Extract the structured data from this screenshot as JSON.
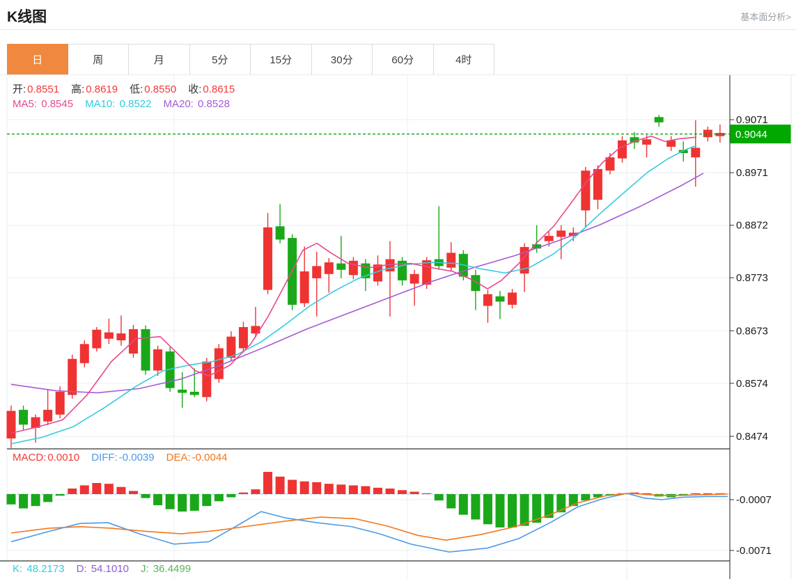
{
  "header": {
    "title": "K线图",
    "link": "基本面分析>"
  },
  "tabs": {
    "items": [
      {
        "label": "日",
        "selected": true
      },
      {
        "label": "周",
        "selected": false
      },
      {
        "label": "月",
        "selected": false
      },
      {
        "label": "5分",
        "selected": false
      },
      {
        "label": "15分",
        "selected": false
      },
      {
        "label": "30分",
        "selected": false
      },
      {
        "label": "60分",
        "selected": false
      },
      {
        "label": "4时",
        "selected": false
      }
    ]
  },
  "legend": {
    "ohlc": [
      {
        "label": "开:",
        "value": "0.8551"
      },
      {
        "label": "高:",
        "value": "0.8619"
      },
      {
        "label": "低:",
        "value": "0.8550"
      },
      {
        "label": "收:",
        "value": "0.8615"
      }
    ],
    "ma": [
      {
        "label": "MA5:",
        "value": "0.8545",
        "color": "#e8488f"
      },
      {
        "label": "MA10:",
        "value": "0.8522",
        "color": "#33ccdd"
      },
      {
        "label": "MA20:",
        "value": "0.8528",
        "color": "#a55bd6"
      }
    ]
  },
  "macd_legend": [
    {
      "label": "MACD:",
      "value": "0.0010",
      "color": "#f53838"
    },
    {
      "label": "DIFF:",
      "value": "-0.0039",
      "color": "#4d9ae8"
    },
    {
      "label": "DEA:",
      "value": "-0.0044",
      "color": "#f2771c"
    }
  ],
  "kdj_legend": [
    {
      "label": "K:",
      "value": "48.2173",
      "color": "#33ccdd"
    },
    {
      "label": "D:",
      "value": "54.1010",
      "color": "#8e5bd6"
    },
    {
      "label": "J:",
      "value": "36.4499",
      "color": "#58b258"
    }
  ],
  "colors": {
    "up_candle": "#ef3333",
    "down_candle": "#1aa81a",
    "current_price_tag": "#00a800",
    "selected_tab": "#f0883f",
    "grid": "#e9eff6",
    "axis": "#444444"
  },
  "chart_data": [
    {
      "type": "candlestick",
      "panel": "main",
      "title": "K线图 (daily)",
      "y_axis_ticks": [
        0.9071,
        0.8971,
        0.8872,
        0.8773,
        0.8673,
        0.8574,
        0.8474
      ],
      "current_price": 0.9044,
      "current_price_label": "0.9044",
      "grid_vertical_x": [
        250,
        585,
        900
      ],
      "up_color": "#ef3333",
      "down_color": "#1aa81a",
      "candles": [
        [
          0.847,
          0.8532,
          0.8452,
          0.8522
        ],
        [
          0.8524,
          0.8532,
          0.8486,
          0.8496
        ],
        [
          0.849,
          0.8515,
          0.8462,
          0.851
        ],
        [
          0.8502,
          0.8562,
          0.8495,
          0.8524
        ],
        [
          0.8515,
          0.8568,
          0.8508,
          0.8558
        ],
        [
          0.8552,
          0.8628,
          0.8545,
          0.862
        ],
        [
          0.8612,
          0.8655,
          0.8604,
          0.8648
        ],
        [
          0.864,
          0.868,
          0.8634,
          0.8675
        ],
        [
          0.8658,
          0.8696,
          0.8648,
          0.867
        ],
        [
          0.8655,
          0.8702,
          0.8645,
          0.8668
        ],
        [
          0.863,
          0.8684,
          0.8622,
          0.8676
        ],
        [
          0.8676,
          0.8683,
          0.859,
          0.8598
        ],
        [
          0.8598,
          0.8645,
          0.8588,
          0.8638
        ],
        [
          0.8634,
          0.8642,
          0.8558,
          0.8565
        ],
        [
          0.8562,
          0.8595,
          0.8528,
          0.8556
        ],
        [
          0.8558,
          0.8602,
          0.8548,
          0.8552
        ],
        [
          0.8548,
          0.8622,
          0.854,
          0.8615
        ],
        [
          0.8582,
          0.8648,
          0.8575,
          0.864
        ],
        [
          0.8622,
          0.8672,
          0.8615,
          0.8662
        ],
        [
          0.864,
          0.869,
          0.8632,
          0.868
        ],
        [
          0.8668,
          0.8718,
          0.866,
          0.8682
        ],
        [
          0.875,
          0.8895,
          0.8742,
          0.8868
        ],
        [
          0.887,
          0.8912,
          0.8838,
          0.8845
        ],
        [
          0.8848,
          0.8855,
          0.8712,
          0.8722
        ],
        [
          0.8725,
          0.8832,
          0.8718,
          0.8785
        ],
        [
          0.8772,
          0.8822,
          0.87,
          0.8795
        ],
        [
          0.878,
          0.881,
          0.8745,
          0.8802
        ],
        [
          0.88,
          0.8852,
          0.8772,
          0.8788
        ],
        [
          0.8778,
          0.8812,
          0.877,
          0.8805
        ],
        [
          0.88,
          0.8808,
          0.8748,
          0.8772
        ],
        [
          0.8766,
          0.8815,
          0.8758,
          0.8798
        ],
        [
          0.8785,
          0.8842,
          0.87,
          0.8808
        ],
        [
          0.8805,
          0.8812,
          0.8758,
          0.8768
        ],
        [
          0.8762,
          0.8788,
          0.872,
          0.878
        ],
        [
          0.876,
          0.8812,
          0.8752,
          0.8806
        ],
        [
          0.8808,
          0.8908,
          0.8788,
          0.8795
        ],
        [
          0.8792,
          0.884,
          0.8785,
          0.882
        ],
        [
          0.8818,
          0.8825,
          0.8768,
          0.8775
        ],
        [
          0.8778,
          0.8788,
          0.8712,
          0.8748
        ],
        [
          0.872,
          0.875,
          0.8688,
          0.8742
        ],
        [
          0.8738,
          0.8748,
          0.8695,
          0.8728
        ],
        [
          0.8722,
          0.8752,
          0.8715,
          0.8745
        ],
        [
          0.8781,
          0.8838,
          0.8746,
          0.8831
        ],
        [
          0.8836,
          0.8872,
          0.882,
          0.8828
        ],
        [
          0.8842,
          0.886,
          0.8832,
          0.8852
        ],
        [
          0.885,
          0.8872,
          0.8808,
          0.8862
        ],
        [
          0.8852,
          0.8868,
          0.8842,
          0.8858
        ],
        [
          0.89,
          0.8982,
          0.8868,
          0.8975
        ],
        [
          0.892,
          0.8985,
          0.8902,
          0.8978
        ],
        [
          0.8975,
          0.9008,
          0.8968,
          0.9
        ],
        [
          0.8998,
          0.904,
          0.899,
          0.9032
        ],
        [
          0.9038,
          0.9048,
          0.9016,
          0.9028
        ],
        [
          0.9024,
          0.9042,
          0.9,
          0.9034
        ],
        [
          0.9076,
          0.908,
          0.9058,
          0.9066
        ],
        [
          0.902,
          0.904,
          0.9012,
          0.9032
        ],
        [
          0.9014,
          0.903,
          0.8992,
          0.9008
        ],
        [
          0.9,
          0.907,
          0.8945,
          0.9018
        ],
        [
          0.9038,
          0.9058,
          0.903,
          0.9052
        ],
        [
          0.904,
          0.9062,
          0.9028,
          0.9046
        ]
      ],
      "ma5": [
        [
          16,
          0.848
        ],
        [
          55,
          0.8492
        ],
        [
          90,
          0.8505
        ],
        [
          125,
          0.8552
        ],
        [
          160,
          0.8615
        ],
        [
          195,
          0.8658
        ],
        [
          230,
          0.8662
        ],
        [
          255,
          0.863
        ],
        [
          280,
          0.8598
        ],
        [
          300,
          0.8588
        ],
        [
          330,
          0.8608
        ],
        [
          360,
          0.8648
        ],
        [
          385,
          0.87
        ],
        [
          410,
          0.8762
        ],
        [
          435,
          0.8825
        ],
        [
          455,
          0.8838
        ],
        [
          475,
          0.882
        ],
        [
          500,
          0.88
        ],
        [
          530,
          0.8792
        ],
        [
          560,
          0.8798
        ],
        [
          590,
          0.88
        ],
        [
          620,
          0.8792
        ],
        [
          650,
          0.8785
        ],
        [
          680,
          0.8768
        ],
        [
          700,
          0.8752
        ],
        [
          720,
          0.8768
        ],
        [
          745,
          0.88
        ],
        [
          770,
          0.8838
        ],
        [
          795,
          0.887
        ],
        [
          815,
          0.8905
        ],
        [
          840,
          0.895
        ],
        [
          865,
          0.899
        ],
        [
          890,
          0.9018
        ],
        [
          915,
          0.9032
        ],
        [
          935,
          0.904
        ],
        [
          955,
          0.903
        ],
        [
          975,
          0.9035
        ],
        [
          1000,
          0.9038
        ]
      ],
      "ma10": [
        [
          16,
          0.846
        ],
        [
          60,
          0.8472
        ],
        [
          105,
          0.8492
        ],
        [
          150,
          0.8528
        ],
        [
          195,
          0.8568
        ],
        [
          235,
          0.8598
        ],
        [
          270,
          0.8608
        ],
        [
          305,
          0.8615
        ],
        [
          340,
          0.8628
        ],
        [
          375,
          0.8652
        ],
        [
          410,
          0.8685
        ],
        [
          445,
          0.872
        ],
        [
          480,
          0.8748
        ],
        [
          515,
          0.8772
        ],
        [
          550,
          0.8788
        ],
        [
          585,
          0.8798
        ],
        [
          620,
          0.8802
        ],
        [
          655,
          0.88
        ],
        [
          690,
          0.879
        ],
        [
          725,
          0.8782
        ],
        [
          760,
          0.8792
        ],
        [
          795,
          0.8818
        ],
        [
          830,
          0.8855
        ],
        [
          865,
          0.8898
        ],
        [
          900,
          0.8938
        ],
        [
          930,
          0.8972
        ],
        [
          960,
          0.8998
        ],
        [
          985,
          0.9015
        ],
        [
          1000,
          0.9022
        ]
      ],
      "ma20": [
        [
          16,
          0.8572
        ],
        [
          80,
          0.856
        ],
        [
          140,
          0.8556
        ],
        [
          200,
          0.8564
        ],
        [
          260,
          0.8582
        ],
        [
          320,
          0.861
        ],
        [
          380,
          0.8642
        ],
        [
          440,
          0.8676
        ],
        [
          500,
          0.8706
        ],
        [
          560,
          0.8736
        ],
        [
          620,
          0.8766
        ],
        [
          680,
          0.8792
        ],
        [
          740,
          0.8815
        ],
        [
          800,
          0.8842
        ],
        [
          860,
          0.8872
        ],
        [
          920,
          0.8908
        ],
        [
          980,
          0.8948
        ],
        [
          1010,
          0.897
        ]
      ],
      "ma_colors": {
        "ma5": "#e8488f",
        "ma10": "#33ccdd",
        "ma20": "#a55bd6"
      }
    },
    {
      "type": "bar",
      "panel": "macd",
      "y_axis_ticks": [
        -0.0007,
        -0.0071
      ],
      "bars": [
        -0.0013,
        -0.0018,
        -0.0015,
        -0.001,
        -0.0002,
        0.0007,
        0.0011,
        0.0014,
        0.0013,
        0.0009,
        0.0004,
        -0.0005,
        -0.0014,
        -0.0019,
        -0.0022,
        -0.0021,
        -0.0015,
        -0.0009,
        -0.0004,
        0.0002,
        0.0006,
        0.0028,
        0.0022,
        0.0018,
        0.0016,
        0.0015,
        0.0013,
        0.0012,
        0.0011,
        0.001,
        0.0008,
        0.0007,
        0.0005,
        0.0003,
        0.0001,
        -0.0008,
        -0.0018,
        -0.0026,
        -0.0032,
        -0.0038,
        -0.0042,
        -0.0042,
        -0.004,
        -0.0036,
        -0.003,
        -0.0023,
        -0.0015,
        -0.0008,
        -0.0004,
        -0.0001,
        0.0001,
        0.0002,
        0.0001,
        -0.0003,
        -0.0004,
        -0.0002,
        0.0001,
        0.0001,
        0.0001
      ],
      "diff_line": [
        [
          16,
          -0.006
        ],
        [
          70,
          -0.0047
        ],
        [
          115,
          -0.0037
        ],
        [
          155,
          -0.0036
        ],
        [
          200,
          -0.005
        ],
        [
          250,
          -0.0063
        ],
        [
          300,
          -0.006
        ],
        [
          340,
          -0.004
        ],
        [
          375,
          -0.0022
        ],
        [
          410,
          -0.003
        ],
        [
          455,
          -0.0036
        ],
        [
          505,
          -0.0041
        ],
        [
          545,
          -0.005
        ],
        [
          590,
          -0.0063
        ],
        [
          645,
          -0.0073
        ],
        [
          700,
          -0.0068
        ],
        [
          745,
          -0.0056
        ],
        [
          790,
          -0.0036
        ],
        [
          830,
          -0.0016
        ],
        [
          865,
          -0.0006
        ],
        [
          900,
          0.0001
        ],
        [
          925,
          -0.0005
        ],
        [
          950,
          -0.0007
        ],
        [
          980,
          -0.0004
        ],
        [
          1015,
          -0.0003
        ],
        [
          1045,
          -0.0003
        ]
      ],
      "dea_line": [
        [
          16,
          -0.0049
        ],
        [
          70,
          -0.0043
        ],
        [
          115,
          -0.0041
        ],
        [
          160,
          -0.0043
        ],
        [
          210,
          -0.0047
        ],
        [
          260,
          -0.005
        ],
        [
          310,
          -0.0046
        ],
        [
          360,
          -0.004
        ],
        [
          410,
          -0.0034
        ],
        [
          460,
          -0.0029
        ],
        [
          510,
          -0.0031
        ],
        [
          555,
          -0.004
        ],
        [
          600,
          -0.0052
        ],
        [
          640,
          -0.0058
        ],
        [
          690,
          -0.0051
        ],
        [
          740,
          -0.0041
        ],
        [
          790,
          -0.0026
        ],
        [
          830,
          -0.0011
        ],
        [
          870,
          -0.0002
        ],
        [
          905,
          0.0001
        ],
        [
          935,
          -0.0001
        ],
        [
          965,
          -0.0002
        ],
        [
          1000,
          -0.0001
        ],
        [
          1045,
          0.0
        ]
      ],
      "diff_color": "#4d9ae8",
      "dea_color": "#f2771c",
      "zero_line_color": "#a8d8f0"
    }
  ]
}
